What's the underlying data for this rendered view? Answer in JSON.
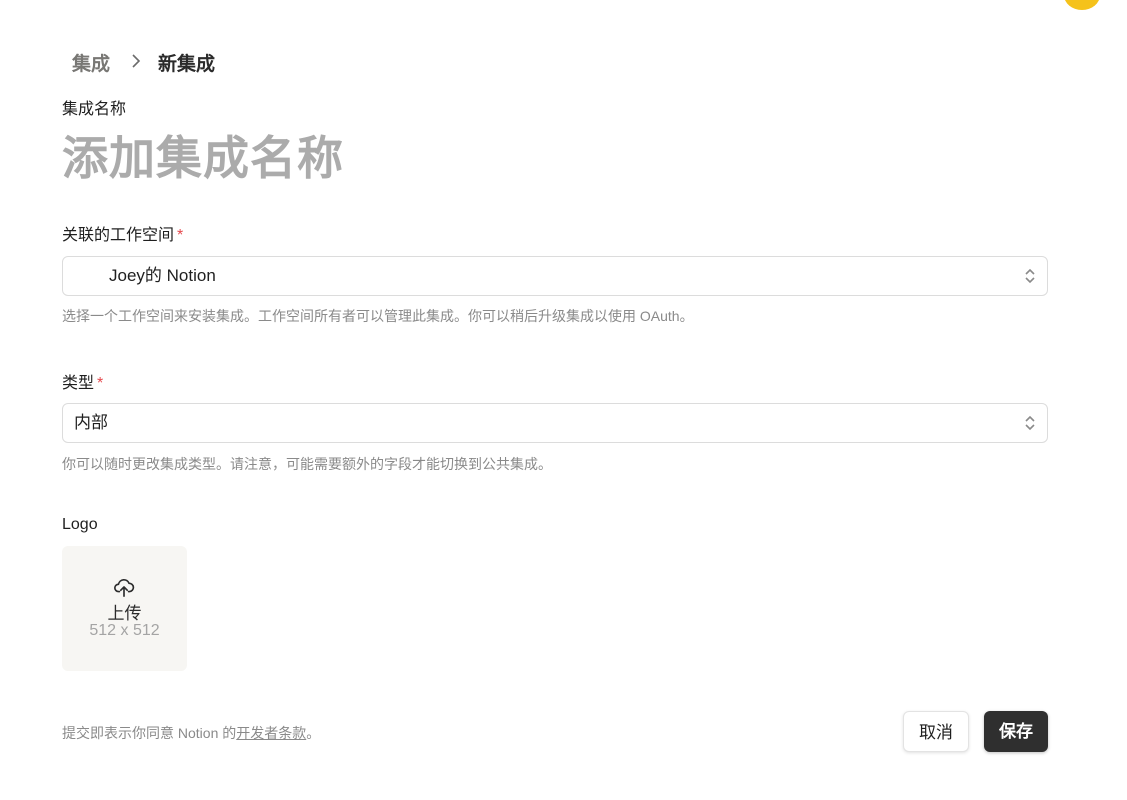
{
  "header": {
    "avatar_color": "#f5c21b"
  },
  "breadcrumb": {
    "parent": "集成",
    "current": "新集成"
  },
  "integration_name": {
    "label": "集成名称",
    "placeholder": "添加集成名称"
  },
  "workspace": {
    "label": "关联的工作空间",
    "required_mark": "*",
    "value": "Joey的 Notion",
    "hint": "选择一个工作空间来安装集成。工作空间所有者可以管理此集成。你可以稍后升级集成以使用 OAuth。"
  },
  "type": {
    "label": "类型",
    "required_mark": "*",
    "value": "内部",
    "hint": "你可以随时更改集成类型。请注意，可能需要额外的字段才能切换到公共集成。"
  },
  "logo": {
    "label": "Logo",
    "upload_label": "上传",
    "size": "512 x 512",
    "icon": "cloud-upload-icon"
  },
  "footer": {
    "note_prefix": "提交即表示你同意 Notion 的",
    "terms_link": "开发者条款",
    "note_suffix": "。",
    "cancel_label": "取消",
    "save_label": "保存"
  },
  "colors": {
    "required": "#e5484d",
    "save_button_bg": "#2f2f2f",
    "placeholder": "#ababab"
  }
}
